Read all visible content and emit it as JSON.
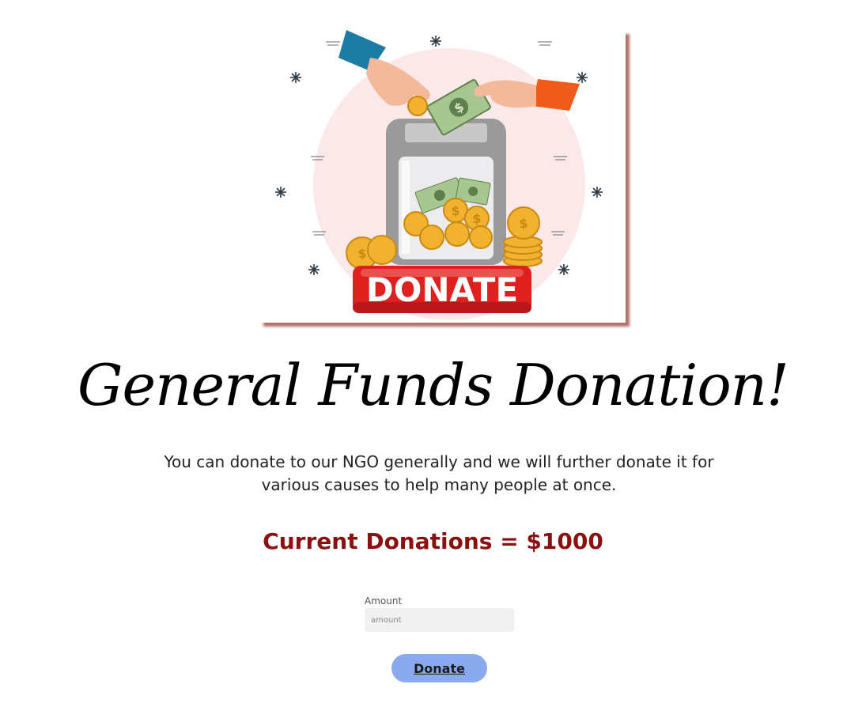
{
  "hero": {
    "badge_text": "DONATE"
  },
  "page_title": "General Funds Donation!",
  "description": "You can donate to our NGO generally and we will further donate it for various causes to help many people at once.",
  "current_donations": "Current Donations = $1000",
  "form": {
    "amount_label": "Amount",
    "amount_placeholder": "amount",
    "amount_value": "",
    "submit_label": "Donate"
  },
  "colors": {
    "accent_dark_red": "#8b1010",
    "button_blue": "#8aa9ee",
    "badge_red": "#e0201f",
    "circle_pink": "#fbe9ea"
  }
}
